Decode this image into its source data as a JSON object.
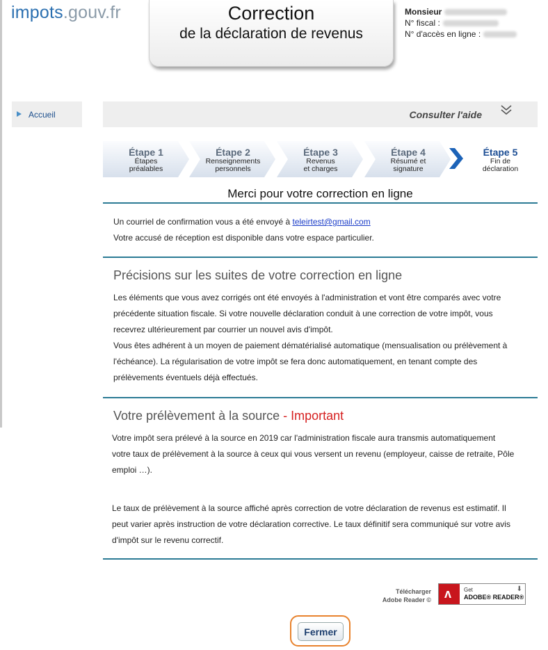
{
  "header": {
    "logo_part1": "impots",
    "logo_part2": ".gouv.fr",
    "title_line1": "Correction",
    "title_line2": "de la déclaration de revenus",
    "user_civility": "Monsieur",
    "fiscal_label": "N° fiscal :",
    "access_label": "N° d'accès en ligne :"
  },
  "sidebar": {
    "home_label": "Accueil"
  },
  "help": {
    "label": "Consulter l'aide"
  },
  "steps": [
    {
      "title": "Étape 1",
      "line1": "Étapes",
      "line2": "préalables"
    },
    {
      "title": "Étape 2",
      "line1": "Renseignements",
      "line2": "personnels"
    },
    {
      "title": "Étape 3",
      "line1": "Revenus",
      "line2": "et charges"
    },
    {
      "title": "Étape 4",
      "line1": "Résumé et",
      "line2": "signature"
    },
    {
      "title": "Étape 5",
      "line1": "Fin de",
      "line2": "déclaration"
    }
  ],
  "main": {
    "title": "Merci pour votre correction en ligne",
    "confirm_text": "Un courriel de confirmation vous a été envoyé à ",
    "email": "teleirtest@gmail.com",
    "receipt_text": "Votre accusé de réception est disponible dans votre espace particulier."
  },
  "section1": {
    "title": "Précisions sur les suites de votre correction en ligne",
    "lines": [
      "Les éléments que vous avez corrigés ont été envoyés à l'administration et vont être comparés avec votre",
      "précédente situation fiscale. Si votre nouvelle déclaration conduit à une correction de votre impôt, vous",
      "recevrez ultérieurement par courrier un nouvel avis d'impôt.",
      "Vous êtes adhérent à un moyen de paiement dématérialisé automatique (mensualisation ou prélèvement à",
      "l'échéance). La régularisation de votre impôt se fera donc automatiquement, en tenant compte des",
      "prélèvements éventuels déjà effectués."
    ]
  },
  "section2": {
    "title": "Votre prélèvement à la source",
    "title_important": " - Important",
    "lines_a": [
      "Votre impôt sera prélevé à la source en 2019 car l'administration fiscale aura transmis automatiquement",
      "votre taux de prélèvement à la source à ceux qui vous versent un revenu (employeur, caisse de retraite, Pôle",
      "emploi …)."
    ],
    "lines_b": [
      "Le taux de prélèvement à la source affiché après correction de votre déclaration de revenus est estimatif. Il",
      "peut varier après instruction de votre déclaration corrective. Le taux définitif sera communiqué sur votre avis",
      "d'impôt sur le revenu correctif."
    ]
  },
  "footer": {
    "download_line1": "Télécharger",
    "download_line2": "Adobe Reader ©",
    "adobe_get": "Get",
    "adobe_reader": "ADOBE® READER®",
    "close_label": "Fermer"
  },
  "icons": {
    "home_arrow": "triangle-right-icon",
    "help_toggle": "double-chevron-down-icon",
    "step_active": "chevron-right-icon",
    "adobe": "adobe-pdf-icon"
  },
  "colors": {
    "brand_blue": "#2a6fb0",
    "rule": "#2a7a94",
    "important": "#d62020",
    "highlight": "#e8822c"
  }
}
